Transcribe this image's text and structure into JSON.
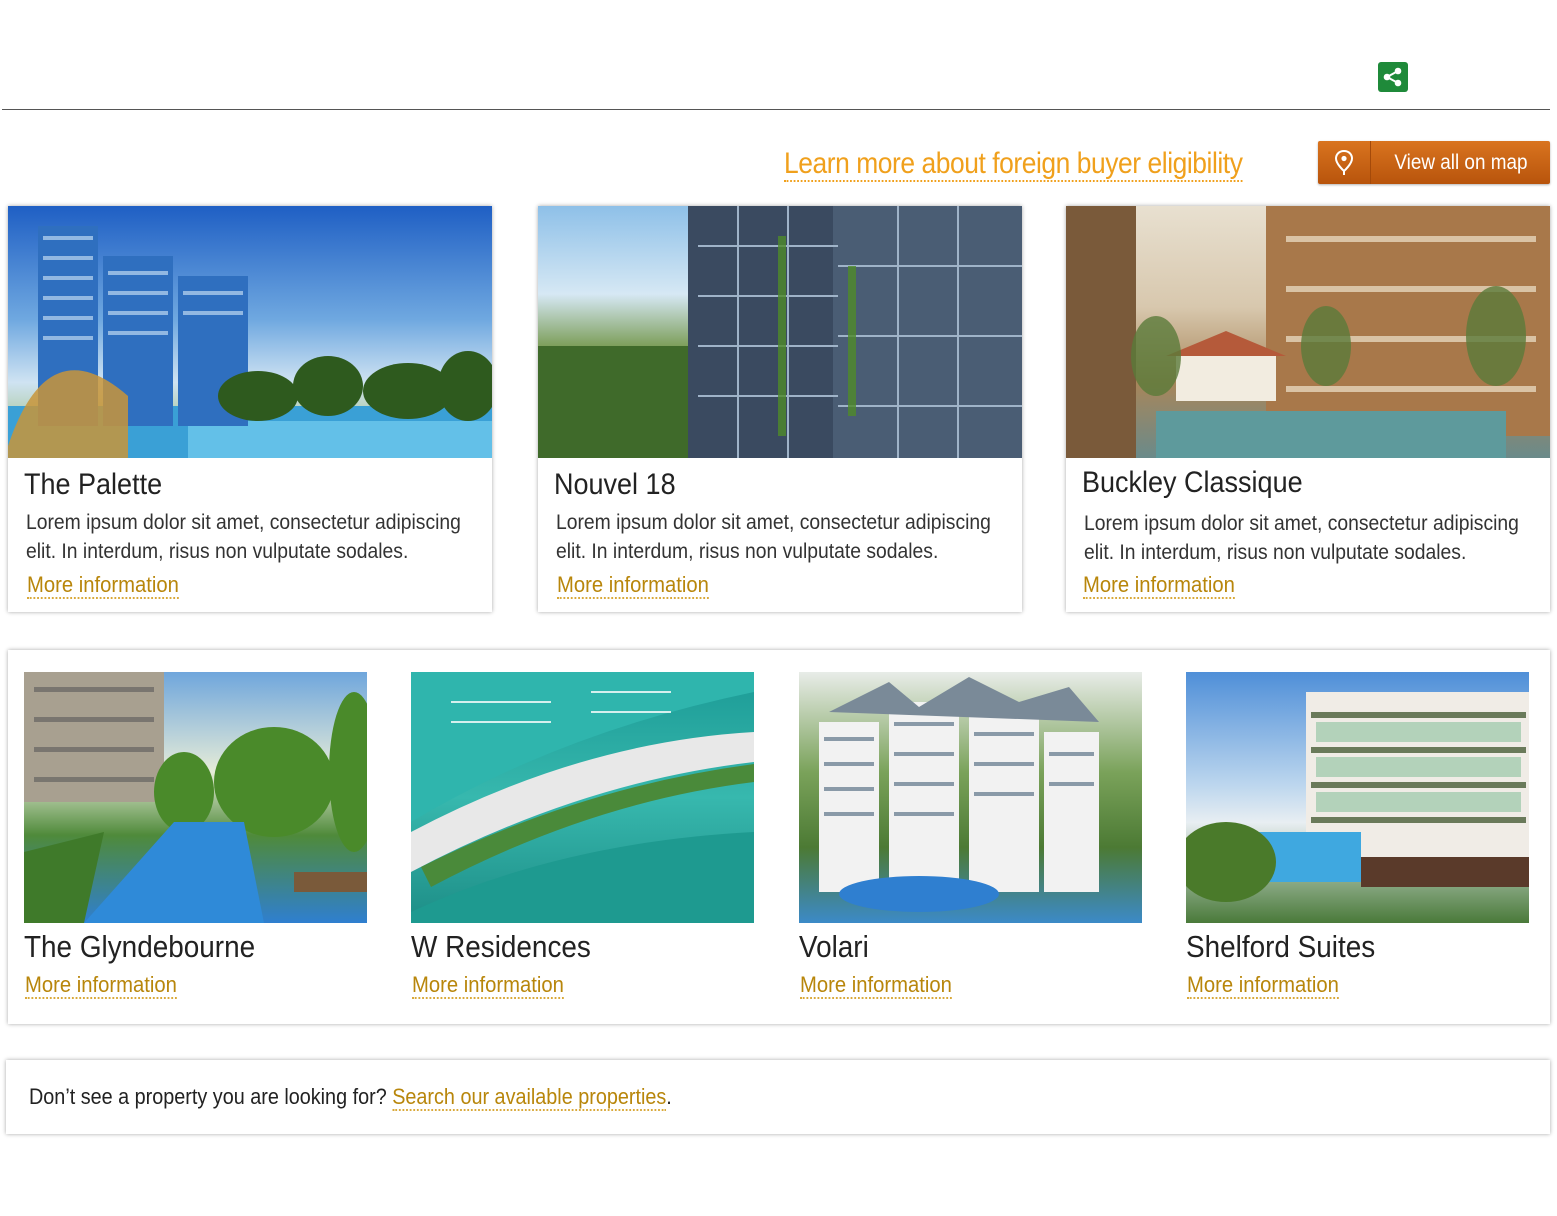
{
  "header": {
    "share_icon": "share-icon"
  },
  "actions": {
    "learn_more_label": "Learn more about foreign buyer eligibility",
    "view_map_label": "View all on map",
    "map_icon": "map-pin-icon"
  },
  "featured": [
    {
      "title": "The Palette",
      "description": "Lorem ipsum dolor sit amet, consectetur adipiscing elit. In interdum, risus non vulputate sodales.",
      "link_label": "More information"
    },
    {
      "title": "Nouvel 18",
      "description": "Lorem ipsum dolor sit amet, consectetur adipiscing elit. In interdum, risus non vulputate sodales.",
      "link_label": "More information"
    },
    {
      "title": "Buckley Classique",
      "description": "Lorem ipsum dolor sit amet, consectetur adipiscing elit. In interdum, risus non vulputate sodales.",
      "link_label": "More information"
    }
  ],
  "more_properties": [
    {
      "title": "The Glyndebourne",
      "link_label": "More information"
    },
    {
      "title": "W Residences",
      "link_label": "More information"
    },
    {
      "title": "Volari",
      "link_label": "More information"
    },
    {
      "title": "Shelford Suites",
      "link_label": "More information"
    }
  ],
  "footer": {
    "prompt": "Don’t see a property you are looking for?",
    "link_label": "Search our available properties",
    "suffix": "."
  },
  "colors": {
    "accent_link": "#b8860b",
    "learn_link": "#f0a01c",
    "map_button": "#c7621a",
    "share_button": "#1f8a3a"
  }
}
